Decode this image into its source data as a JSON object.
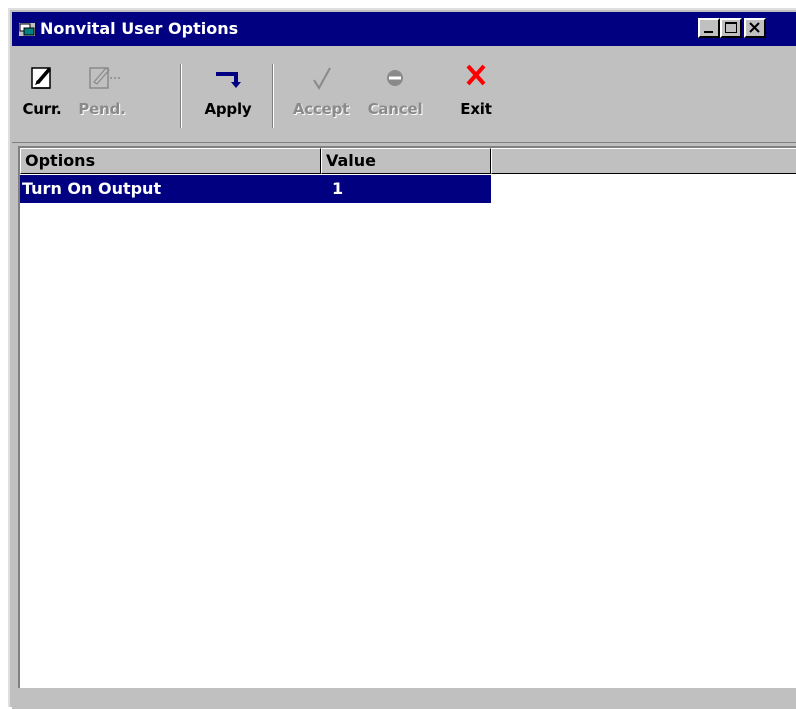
{
  "window": {
    "title": "Nonvital User Options",
    "colors": {
      "titlebar": "#000080",
      "face": "#c0c0c0",
      "selection": "#000080",
      "exit_icon": "#ff0000",
      "apply_icon": "#000080"
    }
  },
  "toolbar": {
    "curr_label": "Curr.",
    "pend_label": "Pend.",
    "apply_label": "Apply",
    "accept_label": "Accept",
    "cancel_label": "Cancel",
    "exit_label": "Exit"
  },
  "list": {
    "columns": [
      "Options",
      "Value"
    ],
    "rows": [
      {
        "option": "Turn On Output",
        "value": "1",
        "selected": true
      }
    ]
  }
}
